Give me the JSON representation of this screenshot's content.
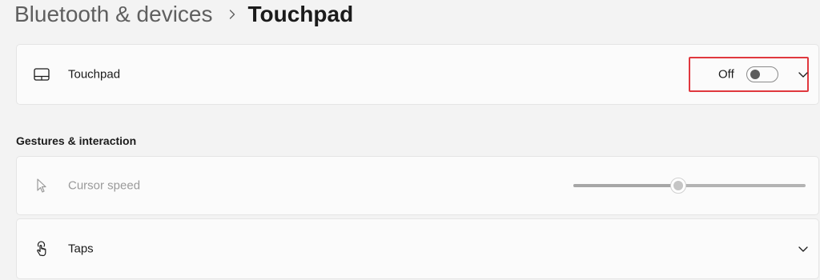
{
  "breadcrumb": {
    "parent": "Bluetooth & devices",
    "separator_icon": "chevron-right-icon",
    "current": "Touchpad"
  },
  "touchpad_row": {
    "icon": "touchpad-icon",
    "label": "Touchpad",
    "state_text": "Off",
    "toggle_on": false,
    "expand_icon": "chevron-down-icon",
    "highlight_color": "#e0383e"
  },
  "gestures_section": {
    "heading": "Gestures & interaction"
  },
  "cursor_speed_row": {
    "icon": "cursor-pointer-icon",
    "label": "Cursor speed",
    "enabled": false,
    "slider_value_fraction": 0.45
  },
  "taps_row": {
    "icon": "tap-hand-icon",
    "label": "Taps",
    "expand_icon": "chevron-down-icon"
  }
}
